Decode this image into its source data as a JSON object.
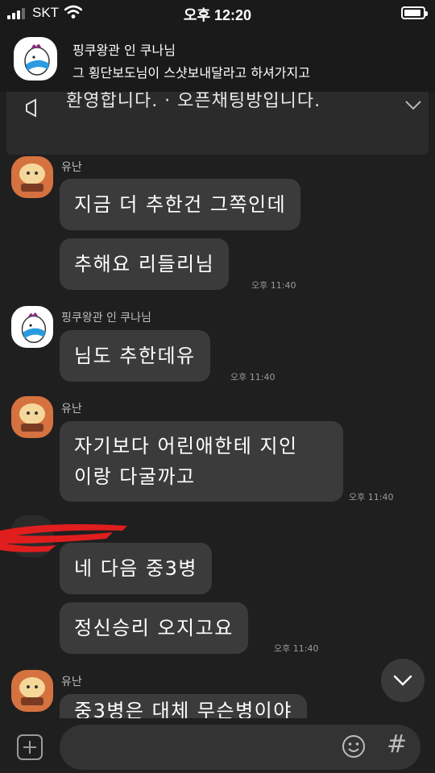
{
  "status_bar": {
    "carrier": "SKT",
    "time": "오후 12:20",
    "battery_level": 0.92
  },
  "notification": {
    "sender": "핑쿠왕관 인 쿠나님",
    "message": "그 횡단보도님이 스샷보내달라고 하셔가지고"
  },
  "notice": {
    "text": "환영합니다. · 오픈채팅방입니다."
  },
  "messages": [
    {
      "sender": "유난",
      "avatar": "orange-cat-avatar",
      "bubbles": [
        "지금 더 추한건 그쪽인데",
        "추해요 리들리님"
      ],
      "time": "오후 11:40"
    },
    {
      "sender": "핑쿠왕관 인 쿠나님",
      "avatar": "white-bird-avatar",
      "bubbles": [
        "님도 추한데유"
      ],
      "time": "오후 11:40"
    },
    {
      "sender": "유난",
      "avatar": "orange-cat-avatar",
      "bubbles": [
        "자기보다 어린애한테 지인\n이랑 다굴까고"
      ],
      "time": "오후 11:40"
    },
    {
      "sender": "",
      "avatar": "redacted-avatar",
      "bubbles": [
        "네 다음 중3병",
        "정신승리 오지고요"
      ],
      "time": "오후 11:40"
    },
    {
      "sender": "유난",
      "avatar": "orange-cat-avatar",
      "bubbles": [
        "중3병은 대체 무슨병이야"
      ],
      "time": ""
    }
  ],
  "input": {
    "placeholder": "",
    "value": ""
  },
  "icons": {
    "plus": "plus-square-icon",
    "emoji": "emoji-icon",
    "hash": "#",
    "scroll_down": "chevron-down-icon"
  },
  "colors": {
    "background": "#1f1f1f",
    "bubble": "#3b3b3b",
    "avatar_orange": "#d5723f",
    "redaction": "#e01e1e"
  }
}
